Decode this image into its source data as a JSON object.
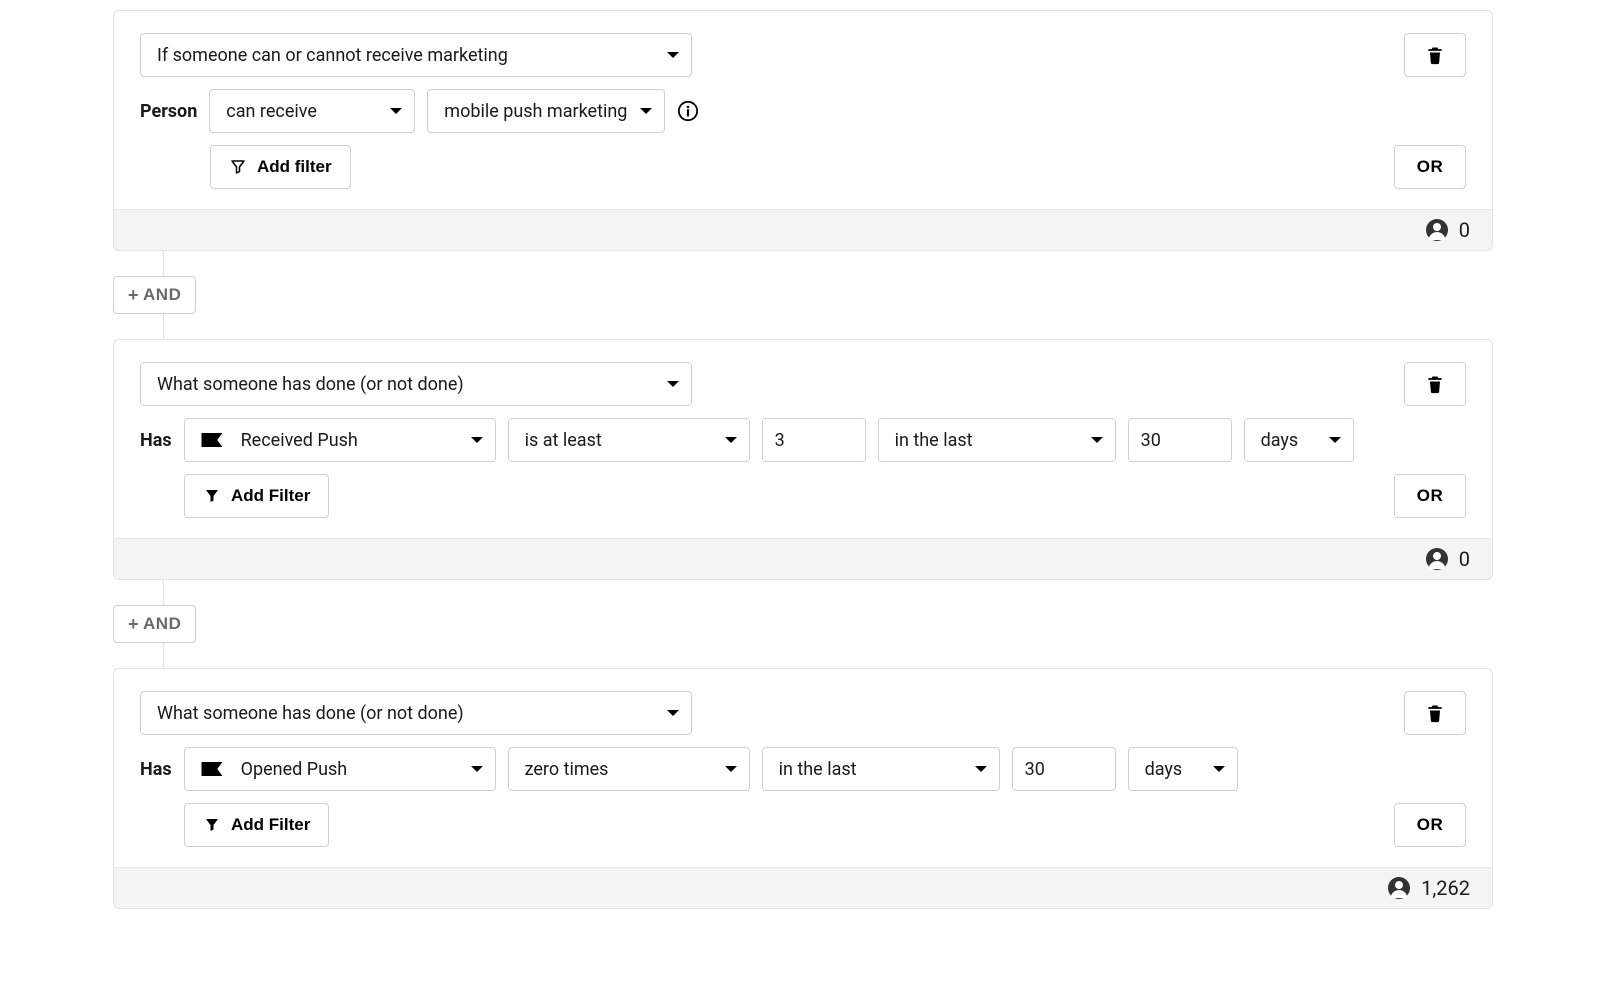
{
  "common": {
    "and_label": "AND",
    "or_label": "OR",
    "add_filter_a": "Add filter",
    "add_filter_b": "Add Filter"
  },
  "blocks": [
    {
      "type_select": "If someone can or cannot receive marketing",
      "line_label": "Person",
      "selects": [
        {
          "label": "can receive"
        },
        {
          "label": "mobile push marketing"
        }
      ],
      "has_info_icon": true,
      "count": "0"
    },
    {
      "type_select": "What someone has done (or not done)",
      "line_label": "Has",
      "selects_flagged": "Received Push",
      "selects": [
        {
          "label": "is at least"
        }
      ],
      "input1": "3",
      "selects2": [
        {
          "label": "in the last"
        }
      ],
      "input2": "30",
      "selects3": [
        {
          "label": "days"
        }
      ],
      "count": "0"
    },
    {
      "type_select": "What someone has done (or not done)",
      "line_label": "Has",
      "selects_flagged": "Opened Push",
      "selects": [
        {
          "label": "zero times"
        }
      ],
      "selects2": [
        {
          "label": "in the last"
        }
      ],
      "input2": "30",
      "selects3": [
        {
          "label": "days"
        }
      ],
      "count": "1,262"
    }
  ]
}
